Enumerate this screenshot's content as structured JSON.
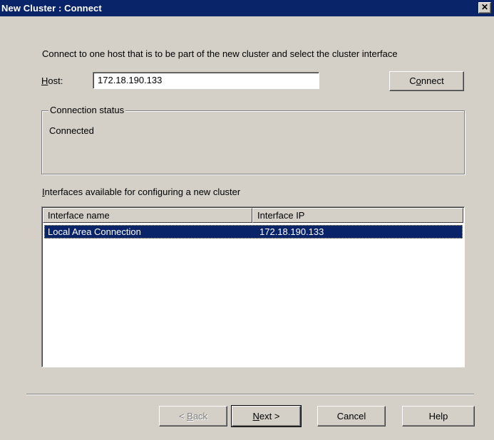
{
  "window": {
    "title": "New Cluster : Connect",
    "close_label": "✕"
  },
  "intro_text": "Connect to one host that is to be part of the new cluster and select the cluster interface",
  "host": {
    "label_mnemonic": "H",
    "label_rest": "ost:",
    "value": "172.18.190.133",
    "connect_mnemonic_pre": "C",
    "connect_mnemonic": "o",
    "connect_rest": "nnect"
  },
  "connection_status": {
    "legend": "Connection status",
    "text": "Connected"
  },
  "interfaces": {
    "label_mnemonic": "I",
    "label_rest": "nterfaces available for configuring a new cluster",
    "columns": [
      "Interface name",
      "Interface IP"
    ],
    "rows": [
      {
        "name": "Local Area Connection",
        "ip": "172.18.190.133",
        "selected": true
      }
    ]
  },
  "buttons": {
    "back_pre": "< ",
    "back_mnemonic": "B",
    "back_rest": "ack",
    "next_mnemonic": "N",
    "next_rest": "ext >",
    "cancel": "Cancel",
    "help": "Help"
  }
}
